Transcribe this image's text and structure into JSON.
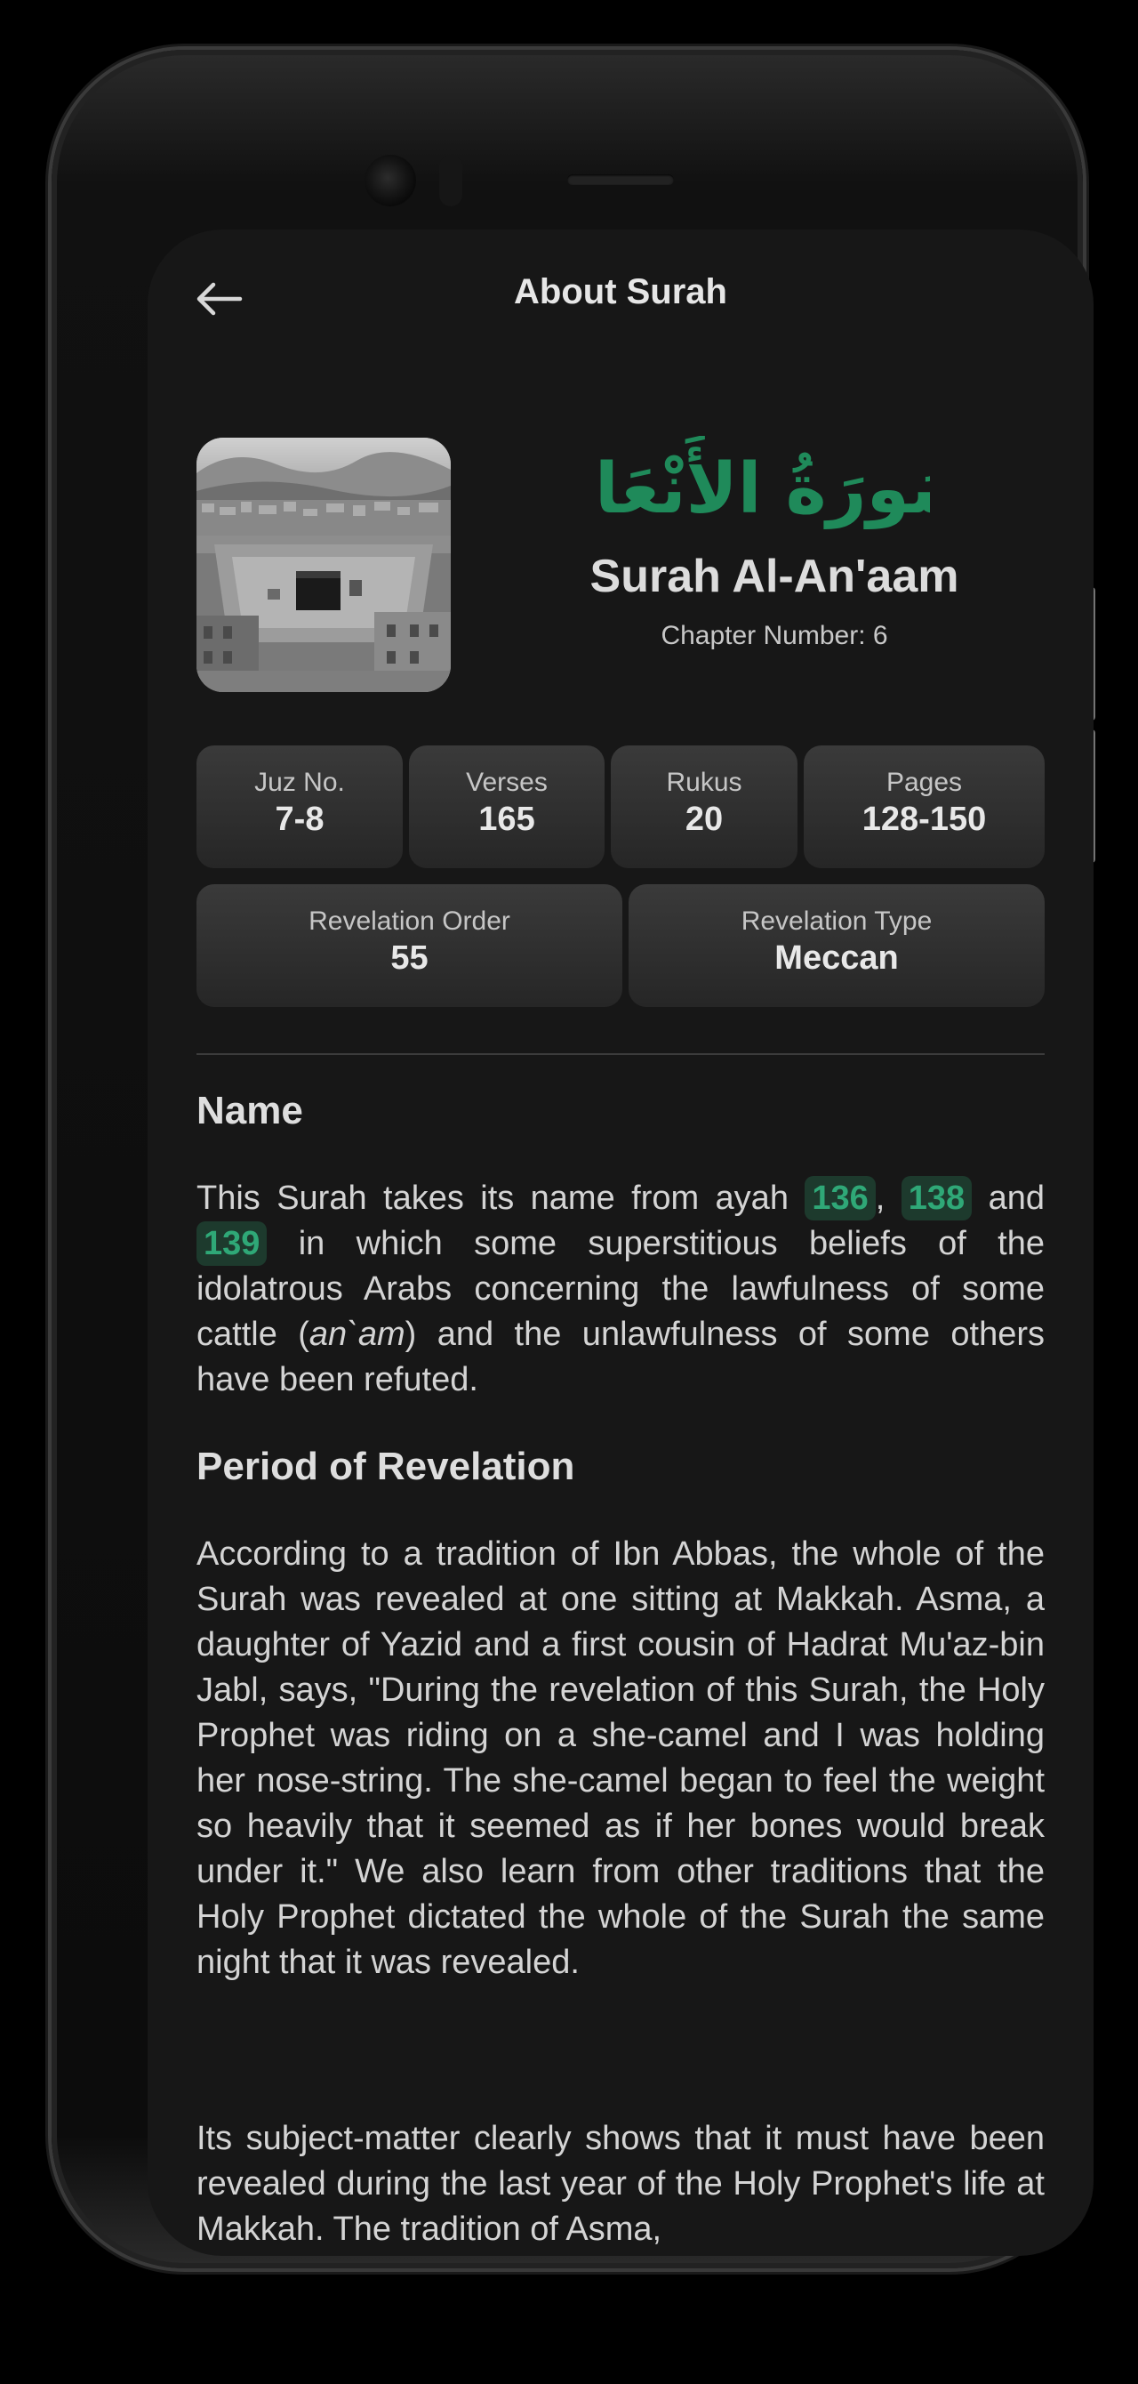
{
  "header": {
    "title": "About Surah"
  },
  "surah": {
    "arabic_name": "سُورَةُ الأَنْعَام",
    "name": "Surah Al-An'aam",
    "chapter_label": "Chapter Number: 6",
    "calligraphy_color": "#1f8a5a"
  },
  "stats": [
    {
      "label": "Juz No.",
      "value": "7-8"
    },
    {
      "label": "Verses",
      "value": "165"
    },
    {
      "label": "Rukus",
      "value": "20"
    },
    {
      "label": "Pages",
      "value": "128-150"
    },
    {
      "label": "Revelation Order",
      "value": "55"
    },
    {
      "label": "Revelation Type",
      "value": "Meccan"
    }
  ],
  "sections": {
    "name_heading": "Name",
    "name_text_1": "This Surah takes its name from ayah",
    "ayah_1": "136",
    "comma": ",",
    "ayah_2": "138",
    "and": "and",
    "ayah_3": "139",
    "name_text_2": "in which some superstitious beliefs of the idolatrous Arabs concerning the lawfulness of some cattle (",
    "name_italic": "an`am",
    "name_text_3": ") and the unlawfulness of some others have been refuted.",
    "period_heading": "Period of Revelation",
    "period_text_1": "According to a tradition of Ibn Abbas, the whole of the Surah was revealed at one sitting at Makkah. Asma, a daughter of Yazid and a first cousin of Hadrat Mu'az-bin Jabl, says, \"During the revelation of this Surah, the Holy Prophet was riding on a she-camel and I was holding her nose-string. The she-camel began to feel the weight so heavily that it seemed as if her bones would break under it.\" We also learn from other traditions that the Holy Prophet dictated the whole of the Surah the same night that it was revealed.",
    "period_text_2": "Its subject-matter clearly shows that it must have been revealed during the last year of the Holy Prophet's life at Makkah. The tradition of Asma,"
  },
  "colors": {
    "accent_green": "#2fa877",
    "background": "#171717"
  }
}
